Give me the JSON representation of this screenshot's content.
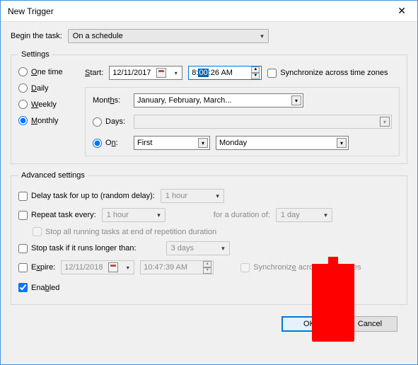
{
  "dialog": {
    "title": "New Trigger"
  },
  "begin": {
    "label": "Begin the task:",
    "value": "On a schedule"
  },
  "settings": {
    "legend": "Settings",
    "freq": {
      "one_time": "One time",
      "daily": "Daily",
      "weekly": "Weekly",
      "monthly": "Monthly",
      "selected": "monthly"
    },
    "start_label": "Start:",
    "start_date": "12/11/2017",
    "start_time_pre": "8:",
    "start_time_sel": "00",
    "start_time_post": ":26 AM",
    "sync_label": "Synchronize across time zones",
    "months_label": "Months:",
    "months_value": "January, February, March...",
    "days_label": "Days:",
    "days_value": "",
    "on_label": "On:",
    "on_occurrence": "First",
    "on_weekday": "Monday",
    "days_on_selected": "on"
  },
  "advanced": {
    "legend": "Advanced settings",
    "delay_label": "Delay task for up to (random delay):",
    "delay_value": "1 hour",
    "repeat_label": "Repeat task every:",
    "repeat_value": "1 hour",
    "duration_label": "for a duration of:",
    "duration_value": "1 day",
    "stop_all_label": "Stop all running tasks at end of repetition duration",
    "stop_longer_label": "Stop task if it runs longer than:",
    "stop_longer_value": "3 days",
    "expire_label": "Expire:",
    "expire_date": "12/11/2018",
    "expire_time": "10:47:39 AM",
    "expire_sync_label": "Synchronize across time zones",
    "enabled_label": "Enabled"
  },
  "buttons": {
    "ok": "OK",
    "cancel": "Cancel"
  }
}
